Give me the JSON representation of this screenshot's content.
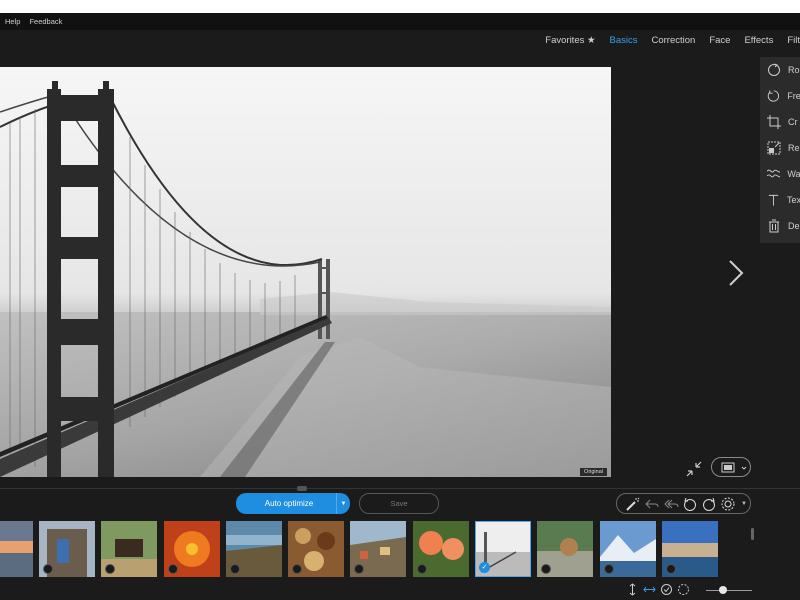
{
  "menubar": {
    "items": [
      "Help",
      "Feedback"
    ]
  },
  "tabs": [
    {
      "label": "Favorites ★",
      "active": false
    },
    {
      "label": "Basics",
      "active": true
    },
    {
      "label": "Correction",
      "active": false
    },
    {
      "label": "Face",
      "active": false
    },
    {
      "label": "Effects",
      "active": false
    },
    {
      "label": "Filt",
      "active": false
    }
  ],
  "viewer": {
    "badge": "Original"
  },
  "panel": {
    "items": [
      {
        "label": "Ro",
        "icon": "rotate-icon"
      },
      {
        "label": "Fre",
        "icon": "free-rotate-icon"
      },
      {
        "label": "Cr",
        "icon": "crop-icon"
      },
      {
        "label": "Re",
        "icon": "resize-icon"
      },
      {
        "label": "Wa",
        "icon": "wave-icon"
      },
      {
        "label": "Tex",
        "icon": "text-icon"
      },
      {
        "label": "De",
        "icon": "delete-icon"
      }
    ]
  },
  "actions": {
    "auto_optimize": "Auto optimize",
    "save": "Save"
  },
  "accent_color": "#1f8de0",
  "filmstrip": {
    "thumbnails": [
      {
        "name": "sunset-beach",
        "selected": false
      },
      {
        "name": "tree-person",
        "selected": false
      },
      {
        "name": "horse-fence",
        "selected": false
      },
      {
        "name": "orange-flower",
        "selected": false
      },
      {
        "name": "coast-cliffs",
        "selected": false
      },
      {
        "name": "dried-fruit",
        "selected": false
      },
      {
        "name": "coastal-village",
        "selected": false
      },
      {
        "name": "orange-blossoms",
        "selected": false
      },
      {
        "name": "golden-gate-bridge",
        "selected": true
      },
      {
        "name": "dog-rocks",
        "selected": false
      },
      {
        "name": "mountain-lake",
        "selected": false
      },
      {
        "name": "waterfront-houses",
        "selected": false
      }
    ]
  }
}
